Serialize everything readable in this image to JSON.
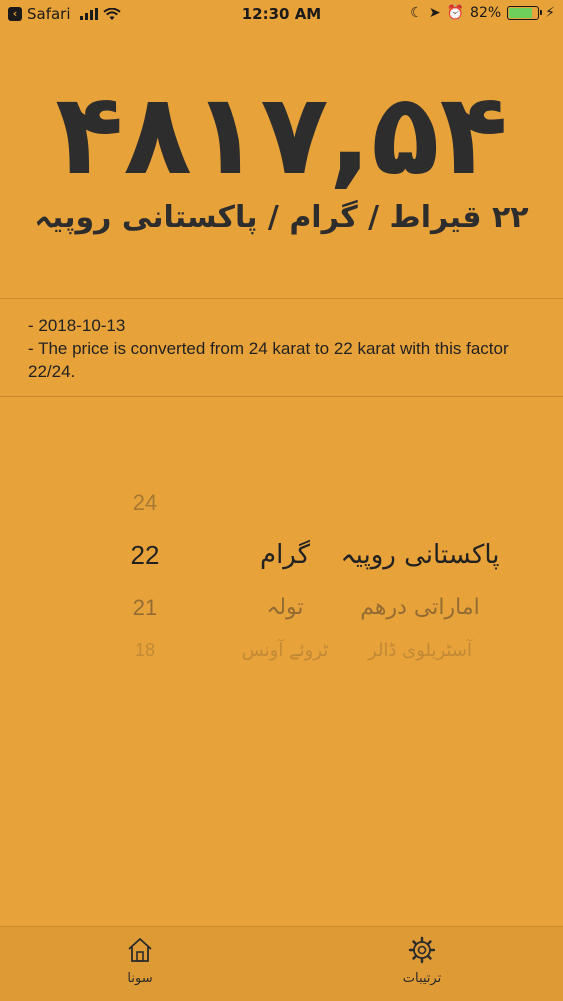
{
  "status_bar": {
    "back_app": "Safari",
    "time": "12:30 AM",
    "battery": "82%",
    "battery_level": 0.82
  },
  "price": {
    "value": "۴۸۱۷,۵۴",
    "subtitle": "۲۲ قیراط / گرام / پاکستانی روپیہ"
  },
  "notes": {
    "date": "- 2018-10-13",
    "conversion": "- The price is converted from 24 karat to 22 karat with this factor 22/24."
  },
  "picker": {
    "karats": [
      "24",
      "22",
      "21",
      "18"
    ],
    "units": [
      "",
      "گرام",
      "تولہ",
      "ٹروئے آونس"
    ],
    "currencies": [
      "",
      "پاکستانی روپیہ",
      "اماراتی درھم",
      "آسٹریلوی ڈالر"
    ],
    "selected": {
      "karat": "22",
      "unit": "گرام",
      "currency": "پاکستانی روپیہ"
    }
  },
  "tabs": {
    "gold": {
      "label": "سونا",
      "icon": "home-icon"
    },
    "settings": {
      "label": "ترتیبات",
      "icon": "gear-icon"
    }
  },
  "colors": {
    "background": "#E8A23A",
    "text": "#2d2d2d",
    "tabbar": "#DD9A35"
  }
}
